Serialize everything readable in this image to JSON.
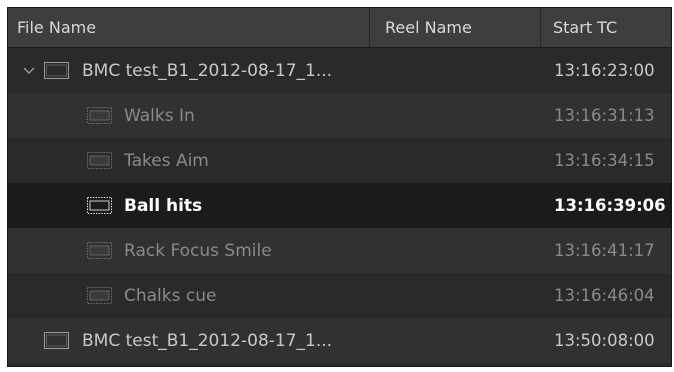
{
  "columns": {
    "file_name": "File Name",
    "reel_name": "Reel Name",
    "start_tc": "Start TC"
  },
  "rows": [
    {
      "name": "BMC test_B1_2012-08-17_1...",
      "start_tc": "13:16:23:00",
      "expanded": true,
      "level": 0
    },
    {
      "name": "Walks In",
      "start_tc": "13:16:31:13",
      "level": 1
    },
    {
      "name": "Takes Aim",
      "start_tc": "13:16:34:15",
      "level": 1
    },
    {
      "name": "Ball hits",
      "start_tc": "13:16:39:06",
      "level": 1,
      "selected": true
    },
    {
      "name": "Rack Focus Smile",
      "start_tc": "13:16:41:17",
      "level": 1
    },
    {
      "name": "Chalks cue",
      "start_tc": "13:16:46:04",
      "level": 1
    },
    {
      "name": "BMC test_B1_2012-08-17_1...",
      "start_tc": "13:50:08:00",
      "level": 0
    }
  ],
  "icons": {
    "expand": "chevron-down-icon",
    "clip": "clip-icon",
    "subclip": "subclip-icon"
  },
  "colors": {
    "background": "#2a2a2a",
    "header": "#3e3e3e",
    "selected_row": "#1b1b1b",
    "selected_text": "#ffffff",
    "dim_text": "#8a8a8a"
  }
}
